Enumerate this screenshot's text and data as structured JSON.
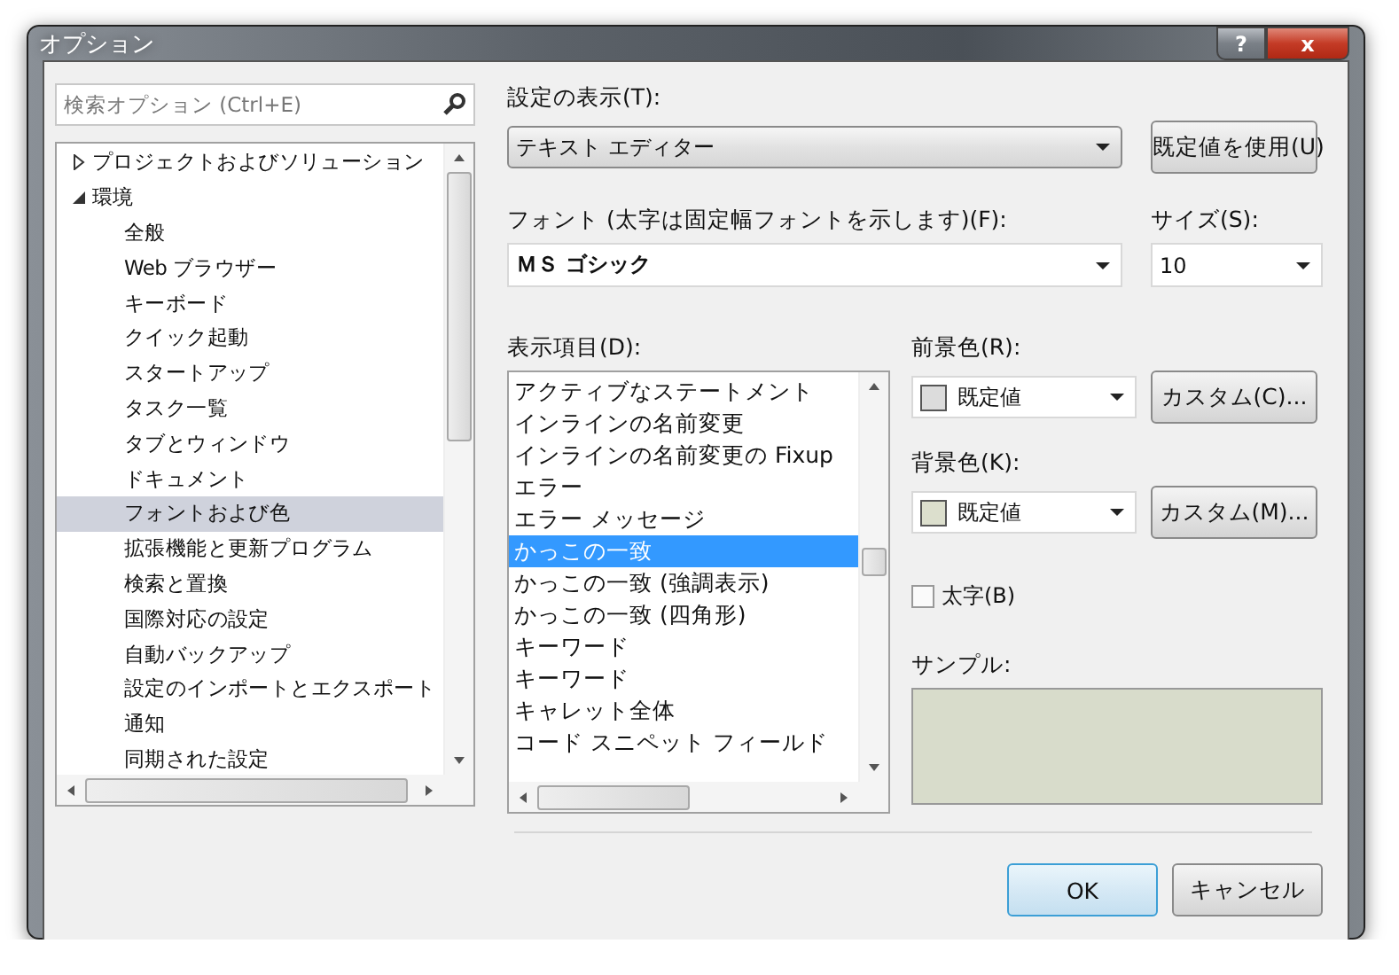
{
  "window": {
    "title": "オプション",
    "buttons": [
      {
        "kind": "help",
        "label": "?"
      },
      {
        "kind": "close",
        "label": "x"
      }
    ]
  },
  "search": {
    "placeholder": "検索オプション (Ctrl+E)"
  },
  "tree": [
    {
      "label": "プロジェクトおよびソリューション",
      "expanded": false,
      "selected": false
    },
    {
      "label": "環境",
      "expanded": true,
      "selected": false,
      "children": [
        {
          "label": "全般",
          "selected": false
        },
        {
          "label": "Web ブラウザー",
          "selected": false
        },
        {
          "label": "キーボード",
          "selected": false
        },
        {
          "label": "クイック起動",
          "selected": false
        },
        {
          "label": "スタートアップ",
          "selected": false
        },
        {
          "label": "タスク一覧",
          "selected": false
        },
        {
          "label": "タブとウィンドウ",
          "selected": false
        },
        {
          "label": "ドキュメント",
          "selected": false
        },
        {
          "label": "フォントおよび色",
          "selected": true
        },
        {
          "label": "拡張機能と更新プログラム",
          "selected": false
        },
        {
          "label": "検索と置換",
          "selected": false
        },
        {
          "label": "国際対応の設定",
          "selected": false
        },
        {
          "label": "自動バックアップ",
          "selected": false
        },
        {
          "label": "設定のインポートとエクスポート",
          "selected": false
        },
        {
          "label": "通知",
          "selected": false
        },
        {
          "label": "同期された設定",
          "selected": false
        }
      ]
    }
  ],
  "settings": {
    "label": "設定の表示(T):",
    "value": "テキスト エディター",
    "default_button": "既定値を使用(U)"
  },
  "font": {
    "label": "フォント (太字は固定幅フォントを示します)(F):",
    "value": "ＭＳ ゴシック"
  },
  "size": {
    "label": "サイズ(S):",
    "value": "10"
  },
  "display_items": {
    "label": "表示項目(D):",
    "items": [
      {
        "label": "アクティブなステートメント",
        "selected": false
      },
      {
        "label": "インラインの名前変更",
        "selected": false
      },
      {
        "label": "インラインの名前変更の Fixup",
        "selected": false
      },
      {
        "label": "エラー",
        "selected": false
      },
      {
        "label": "エラー メッセージ",
        "selected": false
      },
      {
        "label": "かっこの一致",
        "selected": true
      },
      {
        "label": "かっこの一致 (強調表示)",
        "selected": false
      },
      {
        "label": "かっこの一致 (四角形)",
        "selected": false
      },
      {
        "label": "キーワード",
        "selected": false
      },
      {
        "label": "キーワード",
        "selected": false
      },
      {
        "label": "キャレット全体",
        "selected": false
      },
      {
        "label": "コード スニペット フィールド",
        "selected": false
      }
    ]
  },
  "colors": [
    {
      "label": "前景色(R):",
      "value": "既定値",
      "color": "#dcdcdc",
      "button": "カスタム(C)..."
    },
    {
      "label": "背景色(K):",
      "value": "既定値",
      "color": "#dcdfcd",
      "button": "カスタム(M)..."
    }
  ],
  "bold": {
    "label": "太字(B)",
    "checked": false
  },
  "sample": {
    "label": "サンプル:"
  },
  "buttons": [
    {
      "label": "OK",
      "default": true
    },
    {
      "label": "キャンセル",
      "default": false
    }
  ]
}
